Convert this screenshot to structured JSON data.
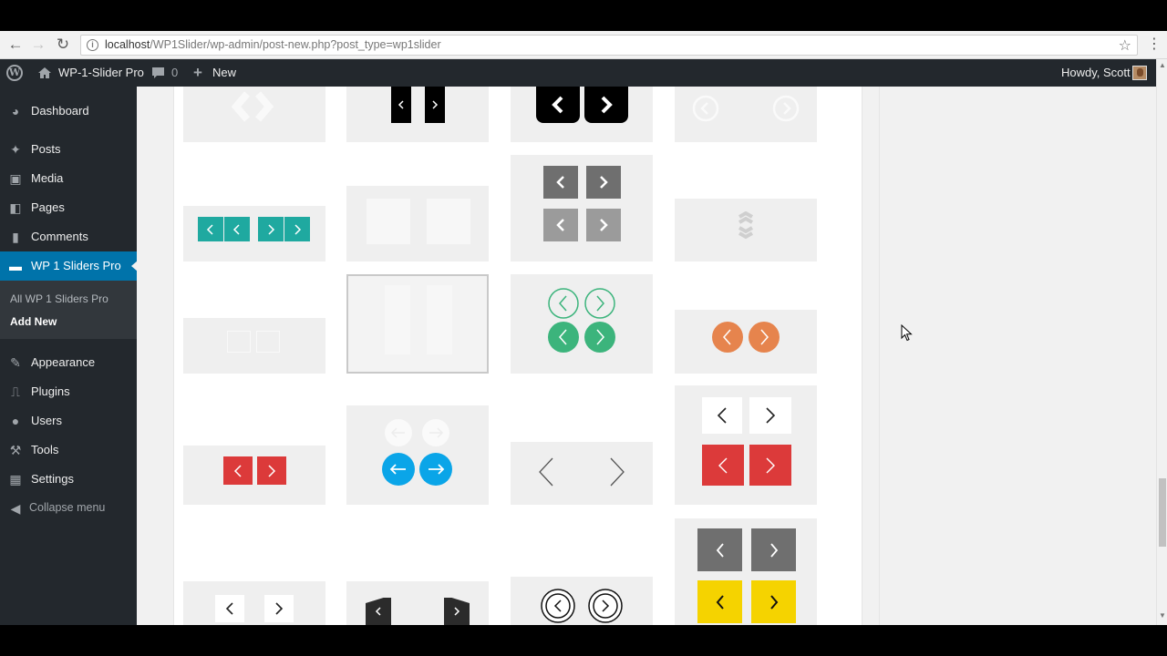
{
  "browser": {
    "url_host": "localhost",
    "url_path": "/WP1Slider/wp-admin/post-new.php?post_type=wp1slider",
    "back_icon": "arrow-left-icon",
    "forward_icon": "arrow-right-icon",
    "reload_icon": "reload-icon",
    "star_icon": "star-icon",
    "menu_icon": "vertical-dots-icon"
  },
  "adminbar": {
    "site_name": "WP-1-Slider Pro",
    "comments_count": "0",
    "new_label": "New",
    "howdy": "Howdy, Scott"
  },
  "sidebar": {
    "items": [
      {
        "label": "Dashboard",
        "icon": "dashboard-icon"
      },
      {
        "label": "Posts",
        "icon": "pin-icon"
      },
      {
        "label": "Media",
        "icon": "media-icon"
      },
      {
        "label": "Pages",
        "icon": "pages-icon"
      },
      {
        "label": "Comments",
        "icon": "comment-icon"
      },
      {
        "label": "WP 1 Sliders Pro",
        "icon": "slider-icon"
      },
      {
        "label": "Appearance",
        "icon": "brush-icon"
      },
      {
        "label": "Plugins",
        "icon": "plugin-icon"
      },
      {
        "label": "Users",
        "icon": "users-icon"
      },
      {
        "label": "Tools",
        "icon": "wrench-icon"
      },
      {
        "label": "Settings",
        "icon": "settings-icon"
      },
      {
        "label": "Collapse menu",
        "icon": "collapse-icon"
      }
    ],
    "submenu": [
      {
        "label": "All WP 1 Sliders Pro"
      },
      {
        "label": "Add New"
      }
    ]
  },
  "colors": {
    "wp_dark": "#23282d",
    "wp_blue": "#0073aa",
    "teal": "#1fa9a0",
    "green": "#3cb47c",
    "orange": "#e6844d",
    "red": "#dc3a3a",
    "blue": "#0aa5e8",
    "gray_btn": "#6f6f6f",
    "yellow": "#f5d300"
  }
}
